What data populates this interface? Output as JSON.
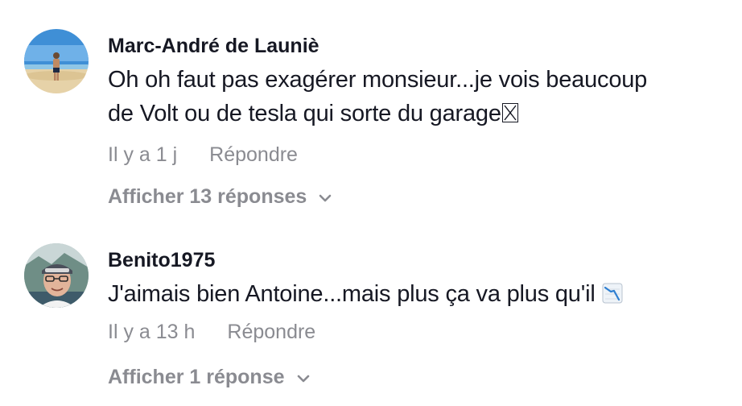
{
  "comments": [
    {
      "username": "Marc-André de Launiè",
      "text_line1": "Oh oh faut pas exagérer monsieur...je vois beaucoup",
      "text_line2": "de Volt ou de tesla qui sorte du garage",
      "time": "Il y a 1 j",
      "reply_label": "Répondre",
      "view_replies": "Afficher 13 réponses",
      "emoji_icon": "missing-glyph-icon"
    },
    {
      "username": "Benito1975",
      "text": "J'aimais bien Antoine...mais plus ça va plus qu'il",
      "time": "Il y a 13 h",
      "reply_label": "Répondre",
      "view_replies": "Afficher 1 réponse",
      "emoji_icon": "chart-decreasing-icon"
    }
  ],
  "colors": {
    "text_primary": "#161823",
    "text_secondary": "#8a8b91",
    "background": "#ffffff"
  }
}
